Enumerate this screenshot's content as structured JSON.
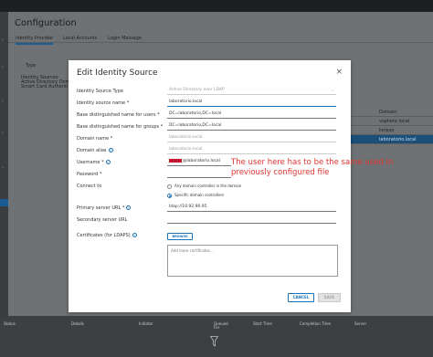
{
  "background": {
    "page_title": "Configuration",
    "tabs": [
      "Identity Provider",
      "Local Accounts",
      "Login Message"
    ],
    "type_header": "Type",
    "left_items": [
      "Identity Sources",
      "Active Directory Dom",
      "Smart Card Authenti"
    ],
    "right_header": "Domain",
    "right_rows": [
      "vsphere.local",
      "lorisos",
      "laboratorio.local"
    ],
    "bottom_columns": [
      "Status",
      "Details",
      "Initiator",
      "Queued For",
      "Start Time",
      "Completion Time",
      "Server"
    ]
  },
  "modal": {
    "title": "Edit Identity Source",
    "close_glyph": "×",
    "fields": [
      {
        "label": "Identity Source Type",
        "value": "Active Directory over LDAP",
        "disabled": true,
        "dropdown": true
      },
      {
        "label": "Identity source name *",
        "value": "laboratorio.local",
        "focus": true
      },
      {
        "label": "Base distinguished name for users *",
        "value": "DC=laboratorio,DC=local"
      },
      {
        "label": "Base distinguished name for groups *",
        "value": "DC=laboratorio,DC=local"
      },
      {
        "label": "Domain name *",
        "value": "laboratorio.local",
        "disabled": true
      },
      {
        "label": "Domain alias",
        "value": "laboratorio.local",
        "disabled": true,
        "info": true
      },
      {
        "label": "Username *",
        "value": "@laboratorio.local",
        "redacted": true,
        "info": true
      },
      {
        "label": "Password *",
        "value": ""
      }
    ],
    "connect_to": {
      "label": "Connect to",
      "options": [
        {
          "label": "Any domain controller in the domain",
          "selected": false
        },
        {
          "label": "Specific domain controllers",
          "selected": true
        }
      ]
    },
    "primary_server": {
      "label": "Primary server URL *",
      "value": "ldap://10.92.90.95"
    },
    "secondary_server": {
      "label": "Secondary server URL",
      "value": ""
    },
    "certificates": {
      "label": "Certificates (for LDAPS)",
      "browse": "BROWSE",
      "placeholder": "Add more certificates..."
    },
    "cancel": "CANCEL",
    "save": "SAVE"
  },
  "annotation": {
    "line1": "The user here has to be the same used in",
    "line2": "previously configured file"
  },
  "colors": {
    "accent": "#1a73b8",
    "annotation": "#e3342f",
    "redaction": "#c0182a"
  }
}
